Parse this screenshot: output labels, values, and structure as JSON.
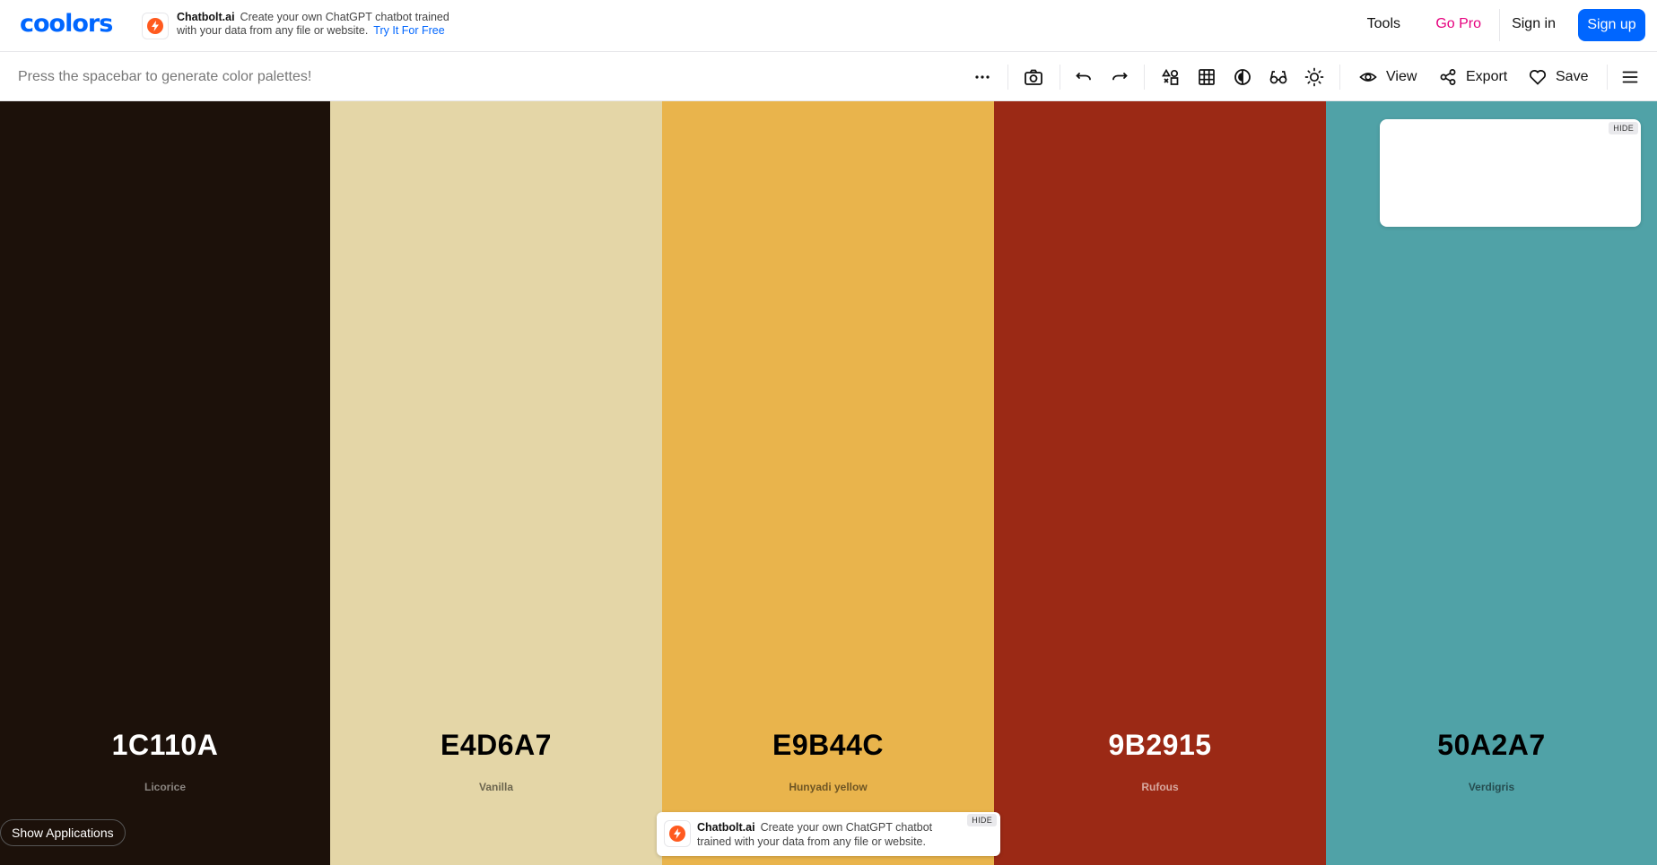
{
  "brand": {
    "logo_text": "coolors"
  },
  "top_ad": {
    "name": "Chatbolt.ai",
    "line1": "Create your own ChatGPT chatbot trained",
    "line2": "with your data from any file or website.",
    "link": "Try It For Free"
  },
  "nav": {
    "tools": "Tools",
    "go_pro": "Go Pro",
    "sign_in": "Sign in",
    "sign_up": "Sign up"
  },
  "toolbar": {
    "hint": "Press the spacebar to generate color palettes!",
    "icons": [
      "more-icon",
      "camera-icon",
      "undo-icon",
      "redo-icon",
      "shapes-icon",
      "grid-icon",
      "contrast-icon",
      "glasses-icon",
      "sun-icon",
      "eye-icon",
      "share-icon",
      "heart-icon",
      "menu-icon"
    ],
    "view": "View",
    "export": "Export",
    "save": "Save"
  },
  "palette": [
    {
      "hex": "1C110A",
      "name": "Licorice",
      "color": "#1C110A",
      "text_color": "#ffffff",
      "name_color": "#8a8580"
    },
    {
      "hex": "E4D6A7",
      "name": "Vanilla",
      "color": "#E4D6A7",
      "text_color": "#000000",
      "name_color": "#6b654e"
    },
    {
      "hex": "E9B44C",
      "name": "Hunyadi yellow",
      "color": "#E9B44C",
      "text_color": "#000000",
      "name_color": "#6e5524"
    },
    {
      "hex": "9B2915",
      "name": "Rufous",
      "color": "#9B2915",
      "text_color": "#ffffff",
      "name_color": "#d7a89f"
    },
    {
      "hex": "50A2A7",
      "name": "Verdigris",
      "color": "#50A2A7",
      "text_color": "#000000",
      "name_color": "#264d50"
    }
  ],
  "side_ad": {
    "hide_label": "HIDE"
  },
  "bottom_ad": {
    "name": "Chatbolt.ai",
    "line1": "Create your own ChatGPT chatbot",
    "line2": "trained with your data from any file or website.",
    "hide_label": "HIDE"
  },
  "show_applications": "Show Applications",
  "colors": {
    "accent": "#0066ff",
    "pro": "#e6007e"
  }
}
